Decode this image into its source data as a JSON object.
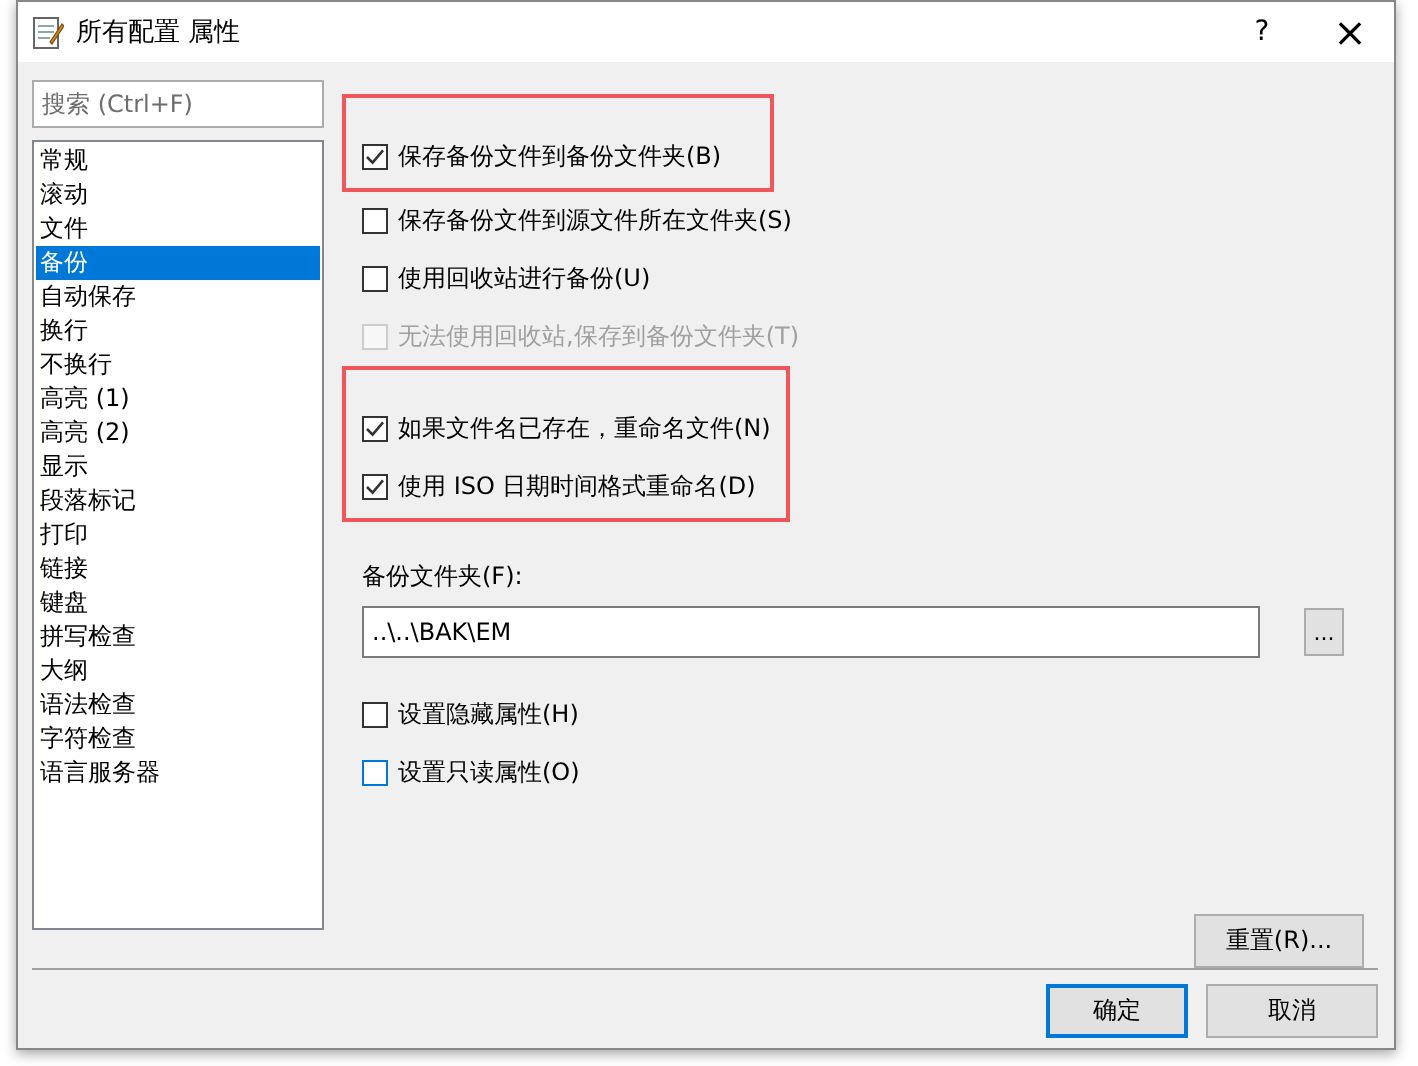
{
  "window": {
    "title": "所有配置 属性",
    "help": "?",
    "close": "×"
  },
  "search": {
    "placeholder": "搜索 (Ctrl+F)"
  },
  "categories": [
    {
      "label": "常规",
      "selected": false
    },
    {
      "label": "滚动",
      "selected": false
    },
    {
      "label": "文件",
      "selected": false
    },
    {
      "label": "备份",
      "selected": true
    },
    {
      "label": "自动保存",
      "selected": false
    },
    {
      "label": "换行",
      "selected": false
    },
    {
      "label": "不换行",
      "selected": false
    },
    {
      "label": "高亮 (1)",
      "selected": false
    },
    {
      "label": "高亮 (2)",
      "selected": false
    },
    {
      "label": "显示",
      "selected": false
    },
    {
      "label": "段落标记",
      "selected": false
    },
    {
      "label": "打印",
      "selected": false
    },
    {
      "label": "链接",
      "selected": false
    },
    {
      "label": "键盘",
      "selected": false
    },
    {
      "label": "拼写检查",
      "selected": false
    },
    {
      "label": "大纲",
      "selected": false
    },
    {
      "label": "语法检查",
      "selected": false
    },
    {
      "label": "字符检查",
      "selected": false
    },
    {
      "label": "语言服务器",
      "selected": false
    }
  ],
  "option_groups": [
    {
      "kind": "highlighted",
      "options": [
        {
          "label": "保存备份文件到备份文件夹(B)",
          "checked": true,
          "disabled": false
        }
      ]
    },
    {
      "kind": "plain",
      "options": [
        {
          "label": "保存备份文件到源文件所在文件夹(S)",
          "checked": false,
          "disabled": false
        },
        {
          "label": "使用回收站进行备份(U)",
          "checked": false,
          "disabled": false
        },
        {
          "label": "无法使用回收站,保存到备份文件夹(T)",
          "checked": false,
          "disabled": true
        }
      ]
    },
    {
      "kind": "highlighted",
      "options": [
        {
          "label": "如果文件名已存在，重命名文件(N)",
          "checked": true,
          "disabled": false
        },
        {
          "label": "使用 ISO 日期时间格式重命名(D)",
          "checked": true,
          "disabled": false
        }
      ]
    }
  ],
  "backup_folder": {
    "label": "备份文件夹(F):",
    "value": "..\\..\\BAK\\EM",
    "browse": "..."
  },
  "attributes": [
    {
      "label": "设置隐藏属性(H)",
      "checked": false,
      "color": "#333333"
    },
    {
      "label": "设置只读属性(O)",
      "checked": false,
      "color": "#0078d7"
    }
  ],
  "reset_button": "重置(R)...",
  "buttons": [
    {
      "label": "确定",
      "default": true
    },
    {
      "label": "取消",
      "default": false
    }
  ]
}
